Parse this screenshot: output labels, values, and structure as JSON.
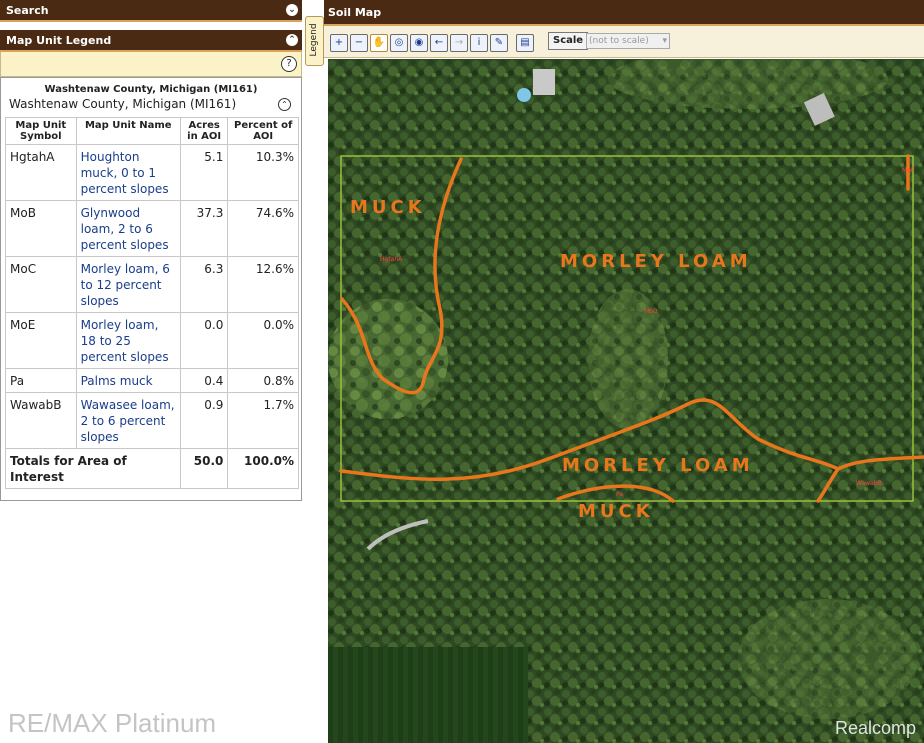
{
  "search_panel": {
    "title": "Search"
  },
  "legend_panel": {
    "title": "Map Unit Legend",
    "county_small": "Washtenaw County, Michigan (MI161)",
    "county": "Washtenaw County, Michigan (MI161)",
    "columns": [
      "Map Unit Symbol",
      "Map Unit Name",
      "Acres in AOI",
      "Percent of AOI"
    ],
    "rows": [
      {
        "symbol": "HgtahA",
        "name": "Houghton muck, 0 to 1 percent slopes",
        "acres": "5.1",
        "percent": "10.3%"
      },
      {
        "symbol": "MoB",
        "name": "Glynwood loam, 2 to 6 percent slopes",
        "acres": "37.3",
        "percent": "74.6%"
      },
      {
        "symbol": "MoC",
        "name": "Morley loam, 6 to 12 percent slopes",
        "acres": "6.3",
        "percent": "12.6%"
      },
      {
        "symbol": "MoE",
        "name": "Morley loam, 18 to 25 percent slopes",
        "acres": "0.0",
        "percent": "0.0%"
      },
      {
        "symbol": "Pa",
        "name": "Palms muck",
        "acres": "0.4",
        "percent": "0.8%"
      },
      {
        "symbol": "WawabB",
        "name": "Wawasee loam, 2 to 6 percent slopes",
        "acres": "0.9",
        "percent": "1.7%"
      }
    ],
    "totals": {
      "label": "Totals for Area of Interest",
      "acres": "50.0",
      "percent": "100.0%"
    }
  },
  "legend_tab": "Legend",
  "map_panel": {
    "title": "Soil Map",
    "scale_button": "Scale",
    "scale_value": "(not to scale)",
    "tools": [
      "zoom-in-icon",
      "zoom-out-icon",
      "pan-hand-icon",
      "full-extent-icon",
      "aoi-icon",
      "back-arrow-icon",
      "forward-arrow-icon",
      "identify-info-icon",
      "measure-ruler-icon",
      "print-icon"
    ]
  },
  "map": {
    "labels": {
      "muck_top": "MUCK",
      "morley_top": "MORLEY LOAM",
      "morley_bottom": "MORLEY LOAM",
      "muck_bottom": "MUCK"
    },
    "unit_labels": {
      "hgtaha": "HgtahA",
      "mod": "MoD",
      "moe": "MoE",
      "pa": "Pa",
      "wawabb": "WawabB"
    }
  },
  "watermarks": {
    "left": "RE/MAX Platinum",
    "right": "Realcomp"
  },
  "colors": {
    "header_brown": "#4b2a14",
    "soil_line": "#e8761c",
    "aoi_outline": "#9bbf3a",
    "link_blue": "#1a3e8c"
  }
}
